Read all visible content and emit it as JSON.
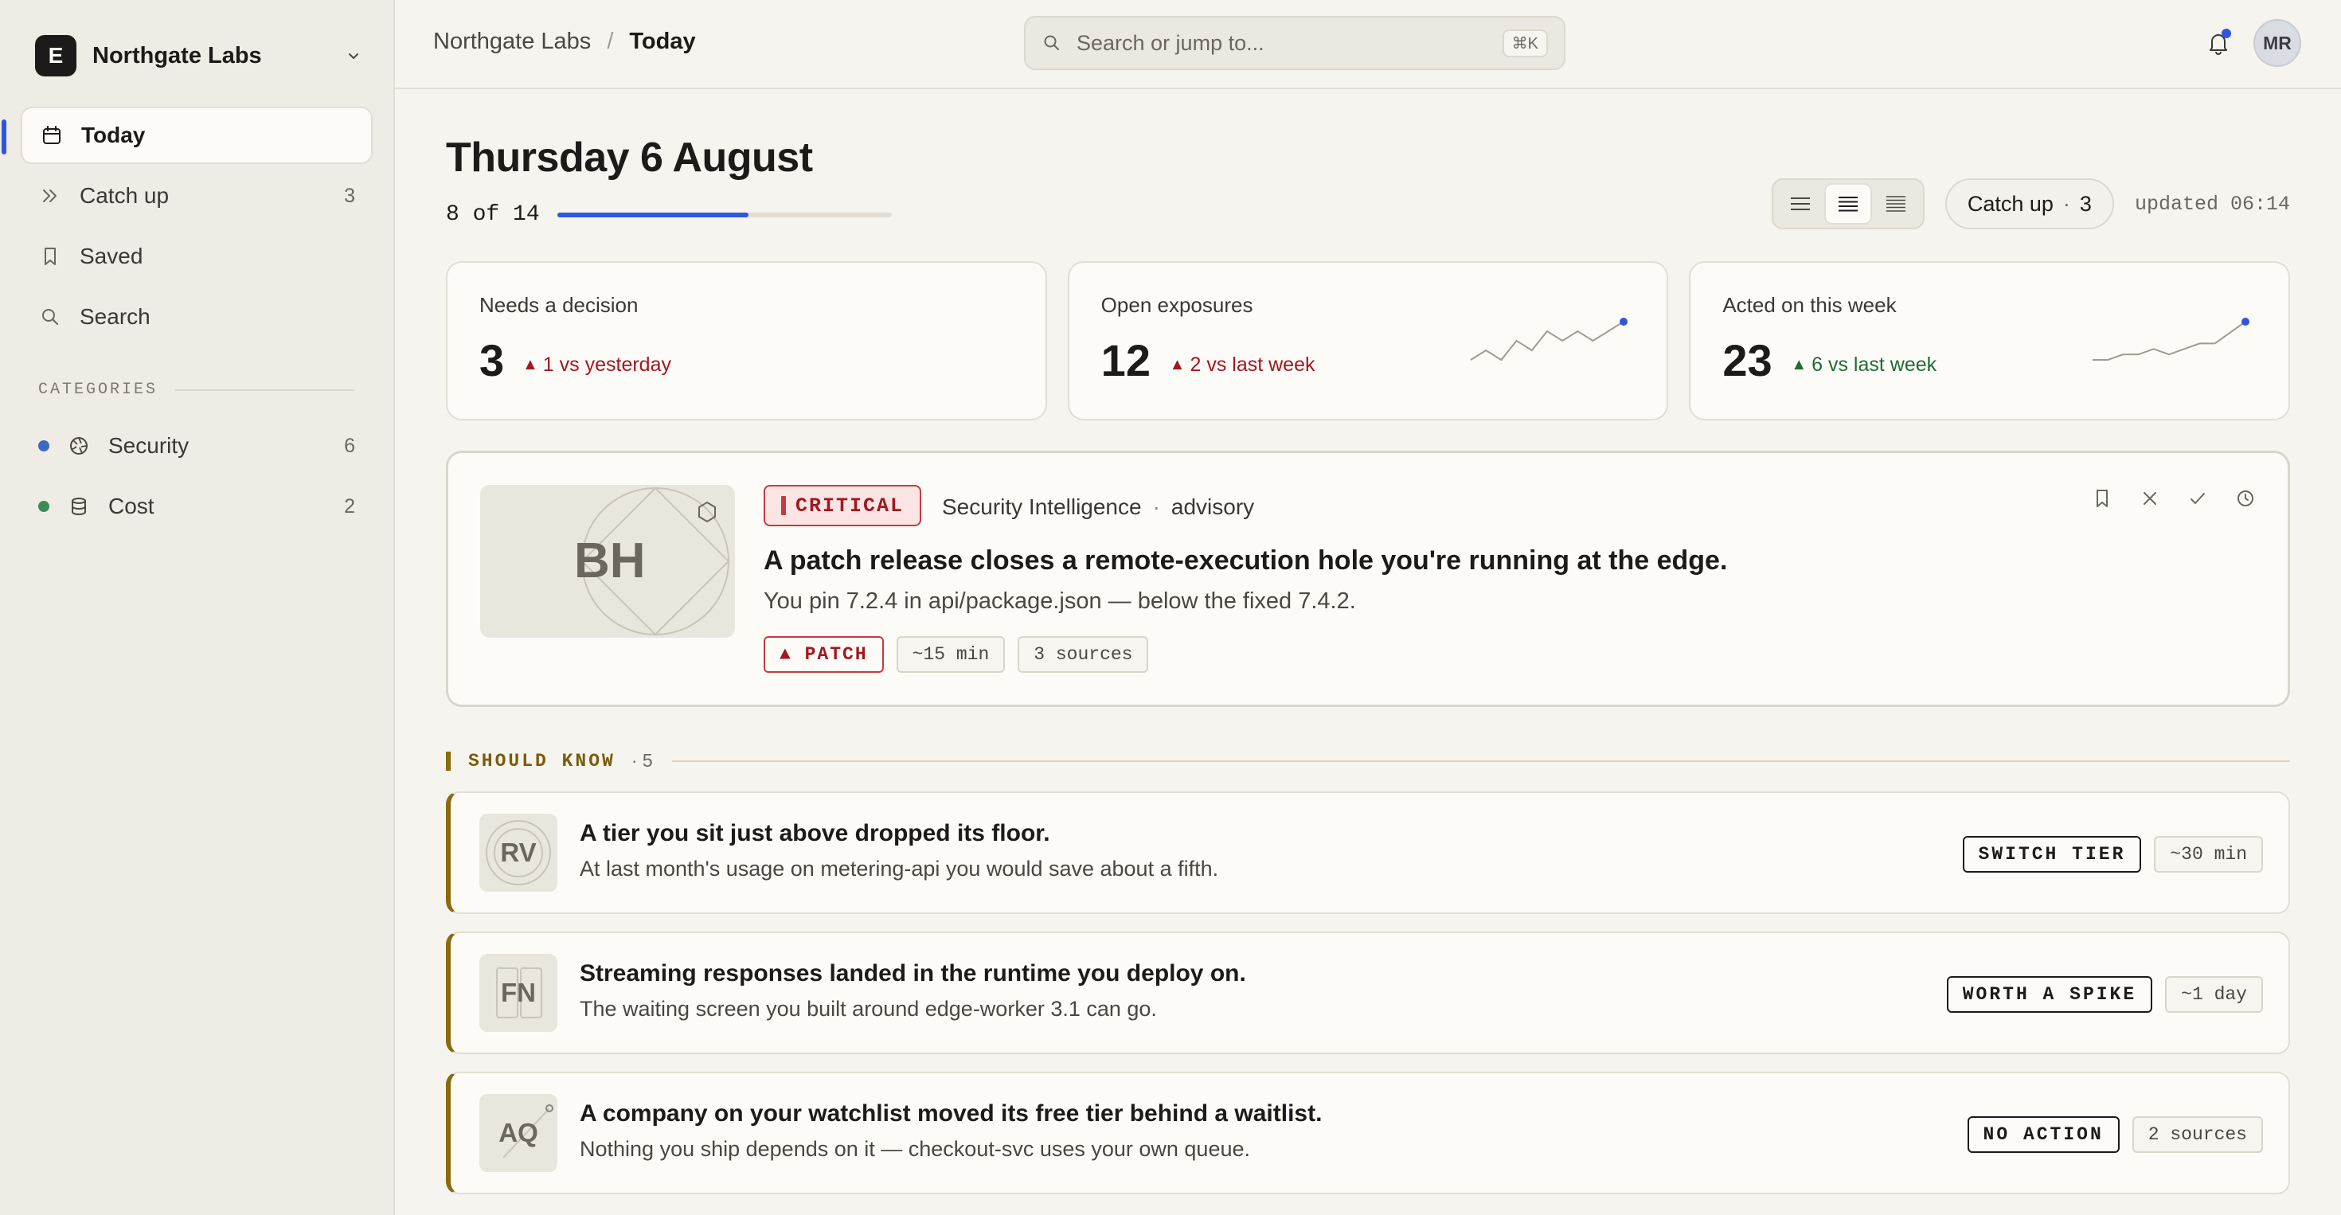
{
  "org": {
    "initial": "E",
    "name": "Northgate Labs"
  },
  "nav": [
    {
      "label": "Today",
      "count": "",
      "icon": "calendar-icon",
      "active": true
    },
    {
      "label": "Catch up",
      "count": "3",
      "icon": "chevrons-right-icon"
    },
    {
      "label": "Saved",
      "count": "",
      "icon": "bookmark-icon"
    },
    {
      "label": "Search",
      "count": "",
      "icon": "search-icon"
    }
  ],
  "categories_heading": "CATEGORIES",
  "categories": [
    {
      "label": "Security",
      "count": "6",
      "dot_color": "#3a6bc4",
      "icon": "aperture-icon"
    },
    {
      "label": "Cost",
      "count": "2",
      "dot_color": "#3d8a55",
      "icon": "database-icon"
    }
  ],
  "topbar": {
    "breadcrumb_root": "Northgate Labs",
    "breadcrumb_sep": "/",
    "breadcrumb_current": "Today",
    "search_placeholder": "Search or jump to...",
    "search_shortcut": "⌘K",
    "avatar_initials": "MR"
  },
  "page": {
    "title": "Thursday 6 August",
    "progress_text": "8 of 14",
    "progress_done": 8,
    "progress_total": 14,
    "catchup_label": "Catch up",
    "catchup_sep": "·",
    "catchup_count": "3",
    "updated": "updated 06:14"
  },
  "stats": [
    {
      "label": "Needs a decision",
      "value": "3",
      "delta": "1 vs yesterday",
      "tone": "bad",
      "spark": []
    },
    {
      "label": "Open exposures",
      "value": "12",
      "delta": "2 vs last week",
      "tone": "bad",
      "spark": [
        3,
        4,
        3,
        5,
        4,
        6,
        5,
        6,
        5,
        6,
        7
      ]
    },
    {
      "label": "Acted on this week",
      "value": "23",
      "delta": "6 vs last week",
      "tone": "good",
      "spark": [
        2,
        2,
        3,
        3,
        4,
        3,
        4,
        5,
        5,
        7,
        9
      ]
    }
  ],
  "critical": {
    "thumb_initials": "BH",
    "badge": "CRITICAL",
    "source": "Security Intelligence",
    "meta_sep": "·",
    "kind": "advisory",
    "title": "A patch release closes a remote-execution hole you're running at the edge.",
    "summary": "You pin 7.2.4 in api/package.json — below the fixed 7.4.2.",
    "tags": [
      "▲ PATCH",
      "~15 min",
      "3 sources"
    ]
  },
  "section": {
    "name": "SHOULD KNOW",
    "count": "· 5"
  },
  "items": [
    {
      "initials": "RV",
      "title": "A tier you sit just above dropped its floor.",
      "summary": "At last month's usage on metering-api you would save about a fifth.",
      "action": "SWITCH TIER",
      "meta": "~30 min"
    },
    {
      "initials": "FN",
      "title": "Streaming responses landed in the runtime you deploy on.",
      "summary": "The waiting screen you built around edge-worker 3.1 can go.",
      "action": "WORTH A SPIKE",
      "meta": "~1 day"
    },
    {
      "initials": "AQ",
      "title": "A company on your watchlist moved its free tier behind a waitlist.",
      "summary": "Nothing you ship depends on it — checkout-svc uses your own queue.",
      "action": "NO ACTION",
      "meta": "2 sources"
    }
  ],
  "colors": {
    "accent": "#2f56e0",
    "critical": "#a31720",
    "should_know": "#8a6a10",
    "good": "#1f6b34"
  }
}
